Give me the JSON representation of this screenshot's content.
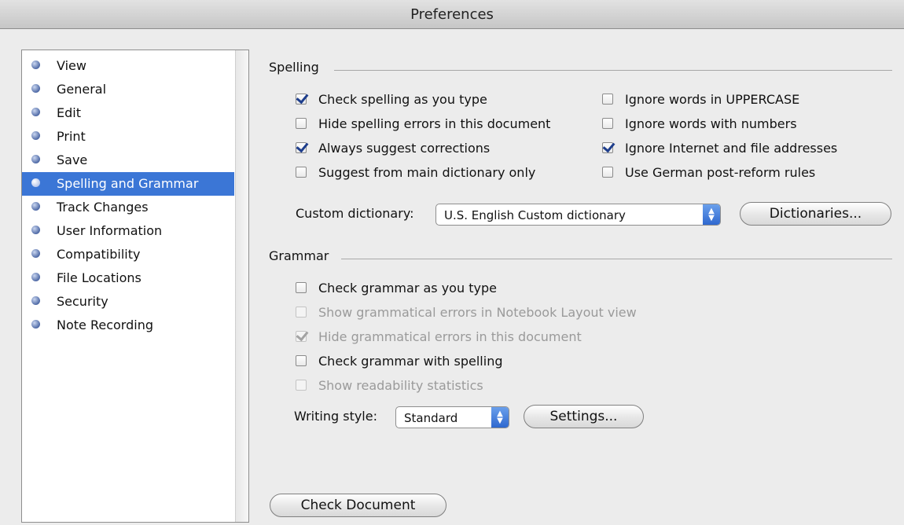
{
  "window": {
    "title": "Preferences"
  },
  "sidebar": {
    "items": [
      {
        "label": "View",
        "selected": false
      },
      {
        "label": "General",
        "selected": false
      },
      {
        "label": "Edit",
        "selected": false
      },
      {
        "label": "Print",
        "selected": false
      },
      {
        "label": "Save",
        "selected": false
      },
      {
        "label": "Spelling and Grammar",
        "selected": true
      },
      {
        "label": "Track Changes",
        "selected": false
      },
      {
        "label": "User Information",
        "selected": false
      },
      {
        "label": "Compatibility",
        "selected": false
      },
      {
        "label": "File Locations",
        "selected": false
      },
      {
        "label": "Security",
        "selected": false
      },
      {
        "label": "Note Recording",
        "selected": false
      }
    ]
  },
  "spelling": {
    "label": "Spelling",
    "options": [
      {
        "label": "Check spelling as you type",
        "checked": true,
        "enabled": true
      },
      {
        "label": "Hide spelling errors in this document",
        "checked": false,
        "enabled": true
      },
      {
        "label": "Always suggest corrections",
        "checked": true,
        "enabled": true
      },
      {
        "label": "Suggest from main dictionary only",
        "checked": false,
        "enabled": true
      },
      {
        "label": "Ignore words in UPPERCASE",
        "checked": false,
        "enabled": true
      },
      {
        "label": "Ignore words with numbers",
        "checked": false,
        "enabled": true
      },
      {
        "label": "Ignore Internet and file addresses",
        "checked": true,
        "enabled": true
      },
      {
        "label": "Use German post-reform rules",
        "checked": false,
        "enabled": true
      }
    ],
    "custom_dictionary": {
      "label": "Custom dictionary:",
      "value": "U.S. English Custom dictionary",
      "button": "Dictionaries..."
    }
  },
  "grammar": {
    "label": "Grammar",
    "options": [
      {
        "label": "Check grammar as you type",
        "checked": false,
        "enabled": true
      },
      {
        "label": "Show grammatical errors in Notebook Layout view",
        "checked": false,
        "enabled": false
      },
      {
        "label": "Hide grammatical errors in this document",
        "checked": true,
        "enabled": false
      },
      {
        "label": "Check grammar with spelling",
        "checked": false,
        "enabled": true
      },
      {
        "label": "Show readability statistics",
        "checked": false,
        "enabled": false
      }
    ],
    "writing_style": {
      "label": "Writing style:",
      "value": "Standard",
      "button": "Settings..."
    }
  },
  "footer": {
    "check_document": "Check Document"
  }
}
